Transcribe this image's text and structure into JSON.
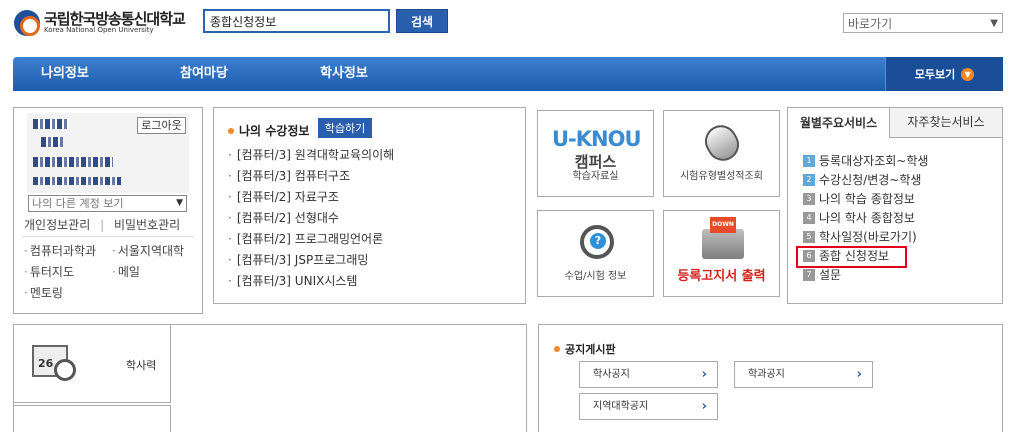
{
  "header": {
    "logo_ko": "국립한국방송통신대학교",
    "logo_en": "Korea National Open University",
    "search_value": "종합신청정보",
    "search_button": "검색",
    "quick_select": "바로가기"
  },
  "nav": {
    "items": [
      "나의정보",
      "참여마당",
      "학사정보"
    ],
    "all_label": "모두보기"
  },
  "profile": {
    "logout": "로그아웃",
    "account_select": "나의 다른 계정 보기",
    "links": [
      "개인정보관리",
      "비밀번호관리"
    ],
    "sub_links": [
      "컴퓨터과학과",
      "서울지역대학",
      "튜터지도",
      "메일",
      "멘토링"
    ]
  },
  "courses": {
    "title": "나의 수강정보",
    "study_button": "학습하기",
    "items": [
      "[컴퓨터/3] 원격대학교육의이해",
      "[컴퓨터/3] 컴퓨터구조",
      "[컴퓨터/2] 자료구조",
      "[컴퓨터/2] 선형대수",
      "[컴퓨터/2] 프로그래밍언어론",
      "[컴퓨터/3] JSP프로그래밍",
      "[컴퓨터/3] UNIX시스템"
    ]
  },
  "tiles": {
    "uknou_logo": "U-KNOU",
    "uknou_sub": "캠퍼스",
    "uknou_label": "학습자료실",
    "exam_label": "시험유형별성적조회",
    "class_label": "수업/시험 정보",
    "print_label": "등록고지서 출력"
  },
  "services": {
    "tab_monthly": "월별주요서비스",
    "tab_frequent": "자주찾는서비스",
    "items": [
      {
        "num": "1",
        "label": "등록대상자조회~학생"
      },
      {
        "num": "2",
        "label": "수강신청/변경~학생"
      },
      {
        "num": "3",
        "label": "나의 학습 종합정보"
      },
      {
        "num": "4",
        "label": "나의 학사 종합정보"
      },
      {
        "num": "5",
        "label": "학사일정(바로가기)"
      },
      {
        "num": "6",
        "label": "종합 신청정보"
      },
      {
        "num": "7",
        "label": "설문"
      }
    ]
  },
  "calendar": {
    "label": "학사력"
  },
  "board": {
    "title": "공지게시판",
    "buttons": [
      "학사공지",
      "학과공지",
      "지역대학공지"
    ]
  },
  "colors": {
    "primary": "#2a5fae",
    "accent": "#f08a2a",
    "highlight": "#e0001b"
  }
}
